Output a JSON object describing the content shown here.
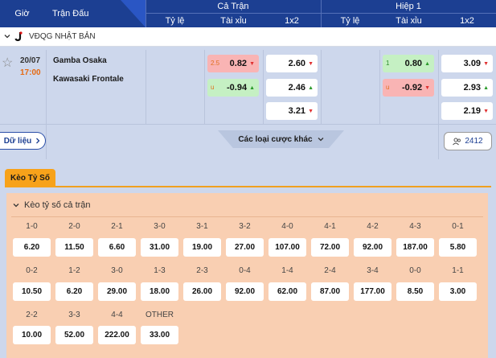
{
  "header": {
    "col_time": "Giờ",
    "col_match": "Trận Đấu",
    "full_match": "Cả Trận",
    "half1": "Hiệp 1",
    "sub_handicap": "Tỷ lệ",
    "sub_overunder": "Tài xỉu",
    "sub_1x2": "1x2"
  },
  "league": {
    "name": "VĐQG NHẬT BẢN"
  },
  "match": {
    "date": "20/07",
    "time": "17:00",
    "home": "Gamba Osaka",
    "away": "Kawasaki Frontale",
    "ft_ou": [
      {
        "line": "2.5",
        "value": "0.82",
        "dir": "down"
      },
      {
        "line": "u",
        "value": "-0.94",
        "dir": "up"
      }
    ],
    "ft_1x2": [
      {
        "value": "2.60",
        "dir": "down"
      },
      {
        "value": "2.46",
        "dir": "up"
      },
      {
        "value": "3.21",
        "dir": "down"
      }
    ],
    "h1_ou": [
      {
        "line": "1",
        "value": "0.80",
        "dir": "up"
      },
      {
        "line": "u",
        "value": "-0.92",
        "dir": "down"
      }
    ],
    "h1_1x2": [
      {
        "value": "3.09",
        "dir": "down"
      },
      {
        "value": "2.93",
        "dir": "up"
      },
      {
        "value": "2.19",
        "dir": "down"
      }
    ],
    "data_label": "Dữ liệu",
    "more_label": "Các loại cược khác",
    "viewers": "2412"
  },
  "tab": {
    "label": "Kèo Tỷ Số"
  },
  "score_panel": {
    "title": "Kèo tỷ số cả trận",
    "rows": [
      [
        {
          "score": "1-0",
          "odd": "6.20"
        },
        {
          "score": "2-0",
          "odd": "11.50"
        },
        {
          "score": "2-1",
          "odd": "6.60"
        },
        {
          "score": "3-0",
          "odd": "31.00"
        },
        {
          "score": "3-1",
          "odd": "19.00"
        },
        {
          "score": "3-2",
          "odd": "27.00"
        },
        {
          "score": "4-0",
          "odd": "107.00"
        },
        {
          "score": "4-1",
          "odd": "72.00"
        },
        {
          "score": "4-2",
          "odd": "92.00"
        },
        {
          "score": "4-3",
          "odd": "187.00"
        },
        {
          "score": "0-1",
          "odd": "5.80"
        }
      ],
      [
        {
          "score": "0-2",
          "odd": "10.50"
        },
        {
          "score": "1-2",
          "odd": "6.20"
        },
        {
          "score": "3-0",
          "odd": "29.00"
        },
        {
          "score": "1-3",
          "odd": "18.00"
        },
        {
          "score": "2-3",
          "odd": "26.00"
        },
        {
          "score": "0-4",
          "odd": "92.00"
        },
        {
          "score": "1-4",
          "odd": "62.00"
        },
        {
          "score": "2-4",
          "odd": "87.00"
        },
        {
          "score": "3-4",
          "odd": "177.00"
        },
        {
          "score": "0-0",
          "odd": "8.50"
        },
        {
          "score": "1-1",
          "odd": "3.00"
        }
      ],
      [
        {
          "score": "2-2",
          "odd": "10.00"
        },
        {
          "score": "3-3",
          "odd": "52.00"
        },
        {
          "score": "4-4",
          "odd": "222.00"
        },
        {
          "score": "OTHER",
          "odd": "33.00"
        }
      ]
    ]
  },
  "colors": {
    "header_bg": "#1c3f92",
    "accent_orange": "#f7a21a",
    "odd_red": "#f9b4b4",
    "odd_green": "#c5f0c3"
  }
}
